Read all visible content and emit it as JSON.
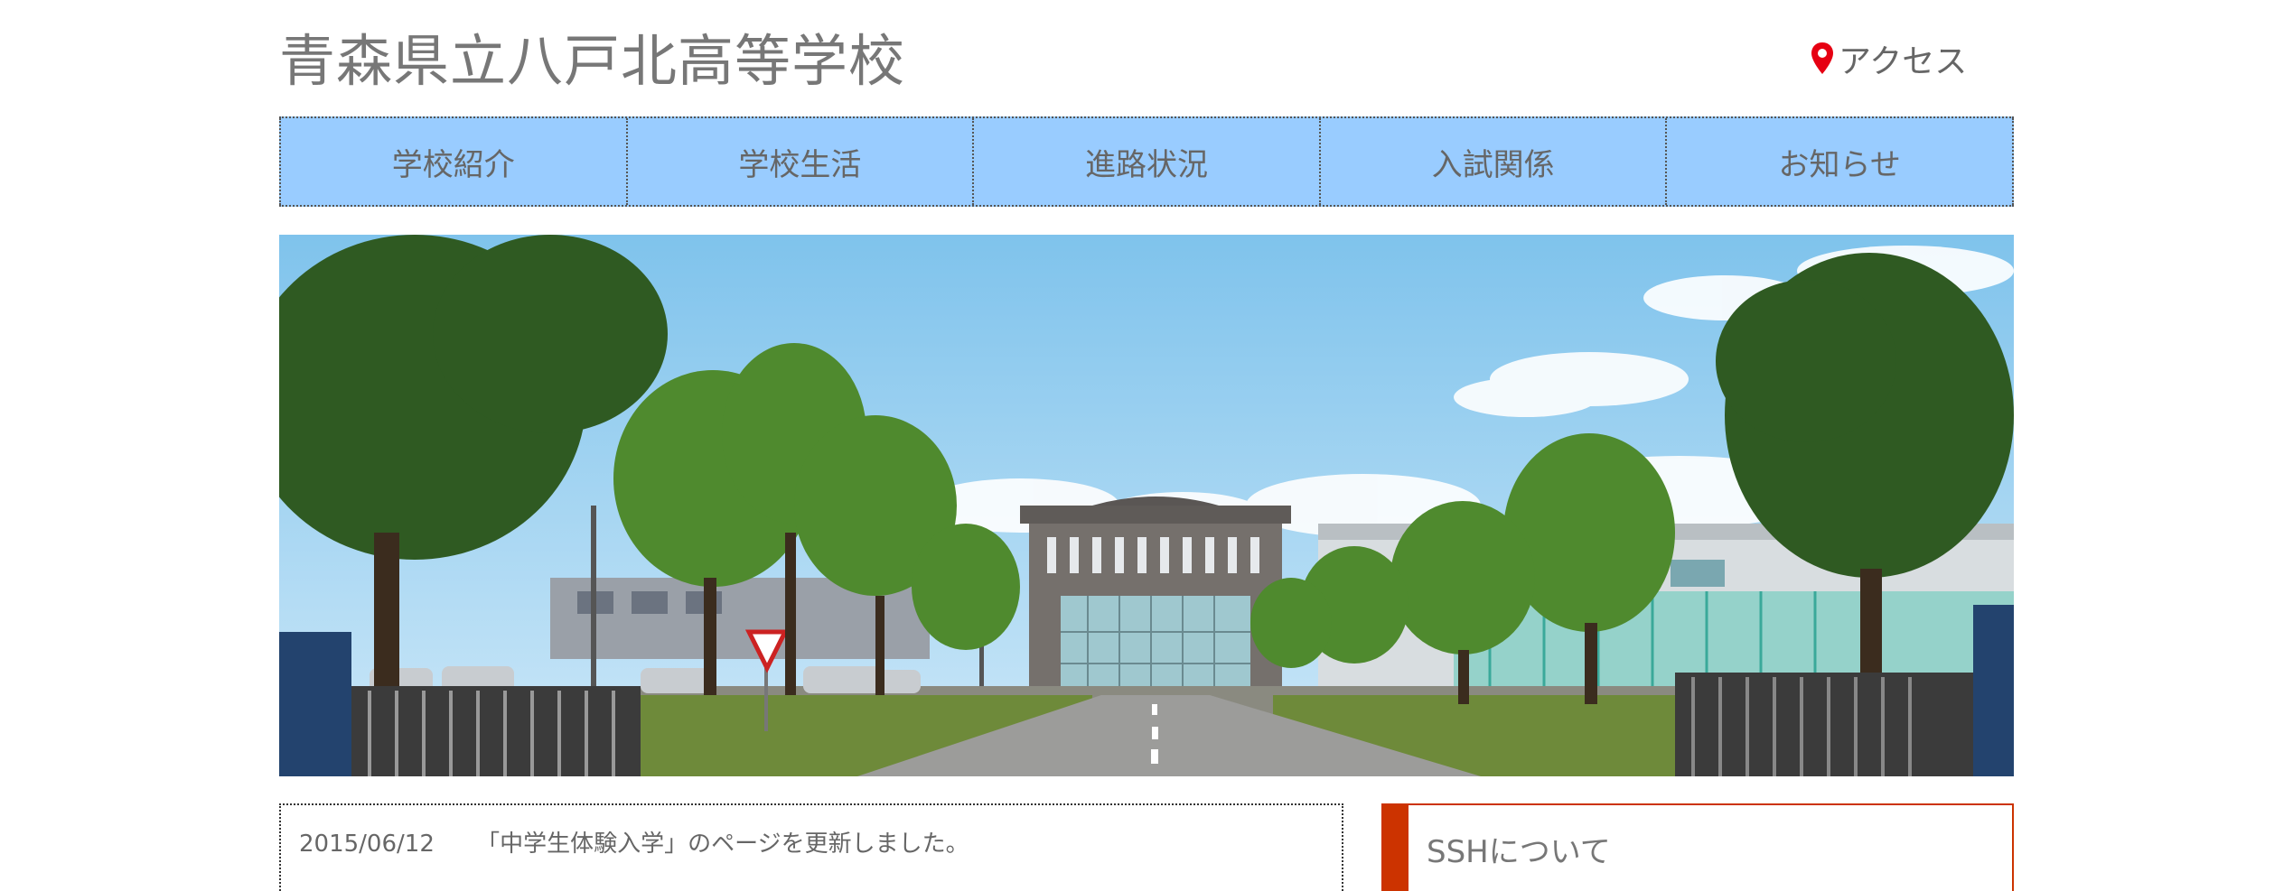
{
  "header": {
    "site_title": "青森県立八戸北高等学校",
    "access_label": "アクセス"
  },
  "nav": {
    "items": [
      {
        "label": "学校紹介"
      },
      {
        "label": "学校生活"
      },
      {
        "label": "進路状況"
      },
      {
        "label": "入試関係"
      },
      {
        "label": "お知らせ"
      }
    ]
  },
  "hero": {
    "description": "school-campus-photo"
  },
  "news": {
    "items": [
      {
        "date": "2015/06/12",
        "text": "「中学生体験入学」のページを更新しました。"
      }
    ]
  },
  "sidebar": {
    "ssh_title": "SSHについて"
  },
  "colors": {
    "nav_bg": "#99ccff",
    "accent": "#cc3300",
    "pin": "#e60012",
    "sky": "#8ec9ec"
  }
}
